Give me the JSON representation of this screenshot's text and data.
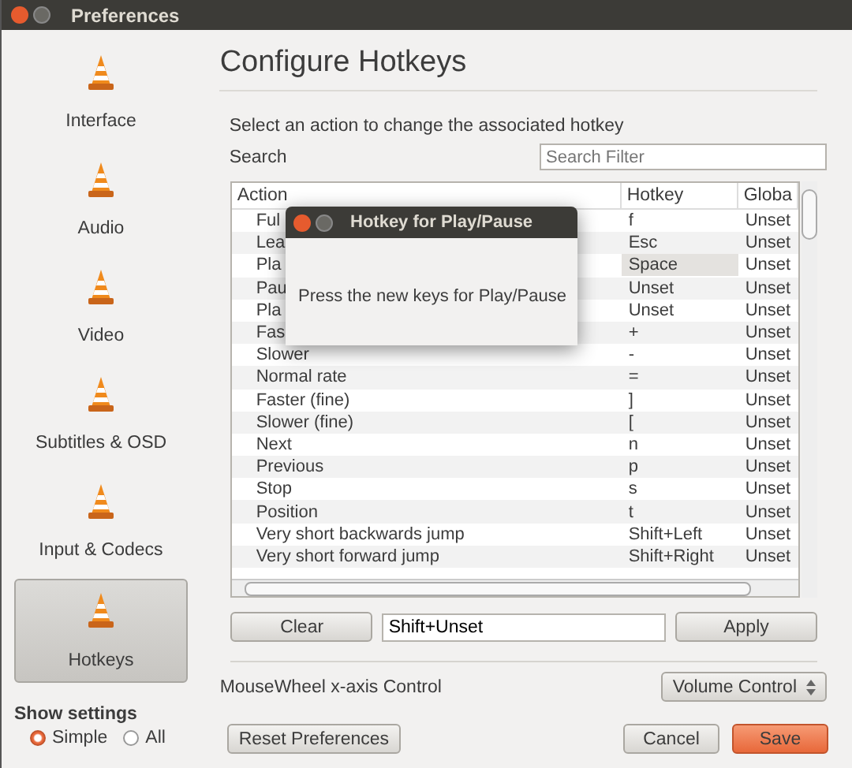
{
  "window": {
    "title": "Preferences"
  },
  "sidebar": {
    "items": [
      {
        "label": "Interface",
        "selected": false
      },
      {
        "label": "Audio",
        "selected": false
      },
      {
        "label": "Video",
        "selected": false
      },
      {
        "label": "Subtitles & OSD",
        "selected": false
      },
      {
        "label": "Input & Codecs",
        "selected": false
      },
      {
        "label": "Hotkeys",
        "selected": true
      }
    ]
  },
  "show_settings": {
    "label": "Show settings",
    "options": [
      {
        "label": "Simple",
        "selected": true
      },
      {
        "label": "All",
        "selected": false
      }
    ]
  },
  "page_title": "Configure Hotkeys",
  "instruction": "Select an action to change the associated hotkey",
  "search": {
    "label": "Search",
    "placeholder": "Search Filter"
  },
  "table": {
    "columns": [
      "Action",
      "Hotkey",
      "Globa"
    ],
    "rows": [
      {
        "cells": [
          "Ful",
          "f",
          "Unset"
        ],
        "selected": false
      },
      {
        "cells": [
          "Lea",
          "Esc",
          "Unset"
        ],
        "selected": false
      },
      {
        "cells": [
          "Pla",
          "Space",
          "Unset"
        ],
        "selected": true
      },
      {
        "cells": [
          "Pau",
          "Unset",
          "Unset"
        ],
        "selected": false
      },
      {
        "cells": [
          "Pla",
          "Unset",
          "Unset"
        ],
        "selected": false
      },
      {
        "cells": [
          "Fas",
          "+",
          "Unset"
        ],
        "selected": false
      },
      {
        "cells": [
          "Slower",
          "-",
          "Unset"
        ],
        "selected": false
      },
      {
        "cells": [
          "Normal rate",
          "=",
          "Unset"
        ],
        "selected": false
      },
      {
        "cells": [
          "Faster (fine)",
          "]",
          "Unset"
        ],
        "selected": false
      },
      {
        "cells": [
          "Slower (fine)",
          "[",
          "Unset"
        ],
        "selected": false
      },
      {
        "cells": [
          "Next",
          "n",
          "Unset"
        ],
        "selected": false
      },
      {
        "cells": [
          "Previous",
          "p",
          "Unset"
        ],
        "selected": false
      },
      {
        "cells": [
          "Stop",
          "s",
          "Unset"
        ],
        "selected": false
      },
      {
        "cells": [
          "Position",
          "t",
          "Unset"
        ],
        "selected": false
      },
      {
        "cells": [
          "Very short backwards jump",
          "Shift+Left",
          "Unset"
        ],
        "selected": false
      },
      {
        "cells": [
          "Very short forward jump",
          "Shift+Right",
          "Unset"
        ],
        "selected": false
      }
    ]
  },
  "clear_button": "Clear",
  "hotkey_value": "Shift+Unset",
  "apply_button": "Apply",
  "mousewheel": {
    "label": "MouseWheel x-axis Control",
    "value": "Volume Control"
  },
  "buttons": {
    "reset": "Reset Preferences",
    "cancel": "Cancel",
    "save": "Save"
  },
  "dialog": {
    "title": "Hotkey for Play/Pause",
    "message": "Press the new keys for Play/Pause"
  }
}
